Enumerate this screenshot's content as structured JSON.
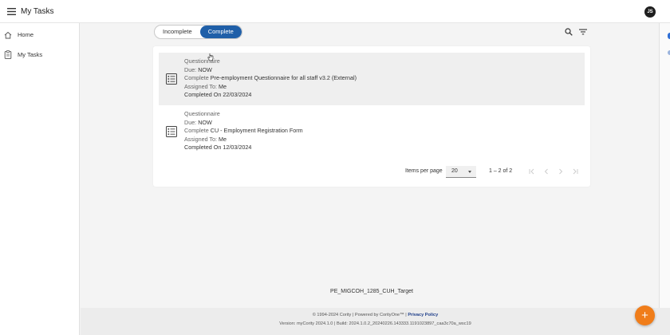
{
  "header": {
    "title": "My Tasks",
    "avatar_initials": "JS"
  },
  "sidebar": {
    "items": [
      {
        "label": "Home",
        "icon": "home-icon"
      },
      {
        "label": "My Tasks",
        "icon": "clipboard-icon"
      }
    ]
  },
  "toolbar": {
    "tabs": [
      {
        "label": "Incomplete",
        "active": false
      },
      {
        "label": "Complete",
        "active": true
      }
    ],
    "search_icon": "search-icon",
    "filter_icon": "filter-icon"
  },
  "tasks": [
    {
      "type": "Questionnaire",
      "due_label": "Due:",
      "due_value": "NOW",
      "action_label": "Complete",
      "action_value": "Pre-employment Questionnaire for all staff v3.2 (External)",
      "assigned_label": "Assigned To:",
      "assigned_value": "Me",
      "completed": "Completed On 22/03/2024"
    },
    {
      "type": "Questionnaire",
      "due_label": "Due:",
      "due_value": "NOW",
      "action_label": "Complete",
      "action_value": "CU - Employment Registration Form",
      "assigned_label": "Assigned To:",
      "assigned_value": "Me",
      "completed": "Completed On 12/03/2024"
    }
  ],
  "paginator": {
    "items_per_page_label": "Items per page",
    "page_size": "20",
    "range": "1 – 2 of 2"
  },
  "environment": "PE_MIGCOH_1285_CUH_Target",
  "footer": {
    "copyright": "© 1994-2024 Cority | Powered by CorityOne™ | ",
    "privacy_link": "Privacy Policy",
    "version": "Version: myCority 2024.1.0 | Build: 2024.1.0.2_20240226.143333.1191023897_caa3c70a_wsc19"
  },
  "fab": {
    "label": "+"
  },
  "colors": {
    "accent": "#1f5fa8",
    "fab": "#f07d1a"
  }
}
